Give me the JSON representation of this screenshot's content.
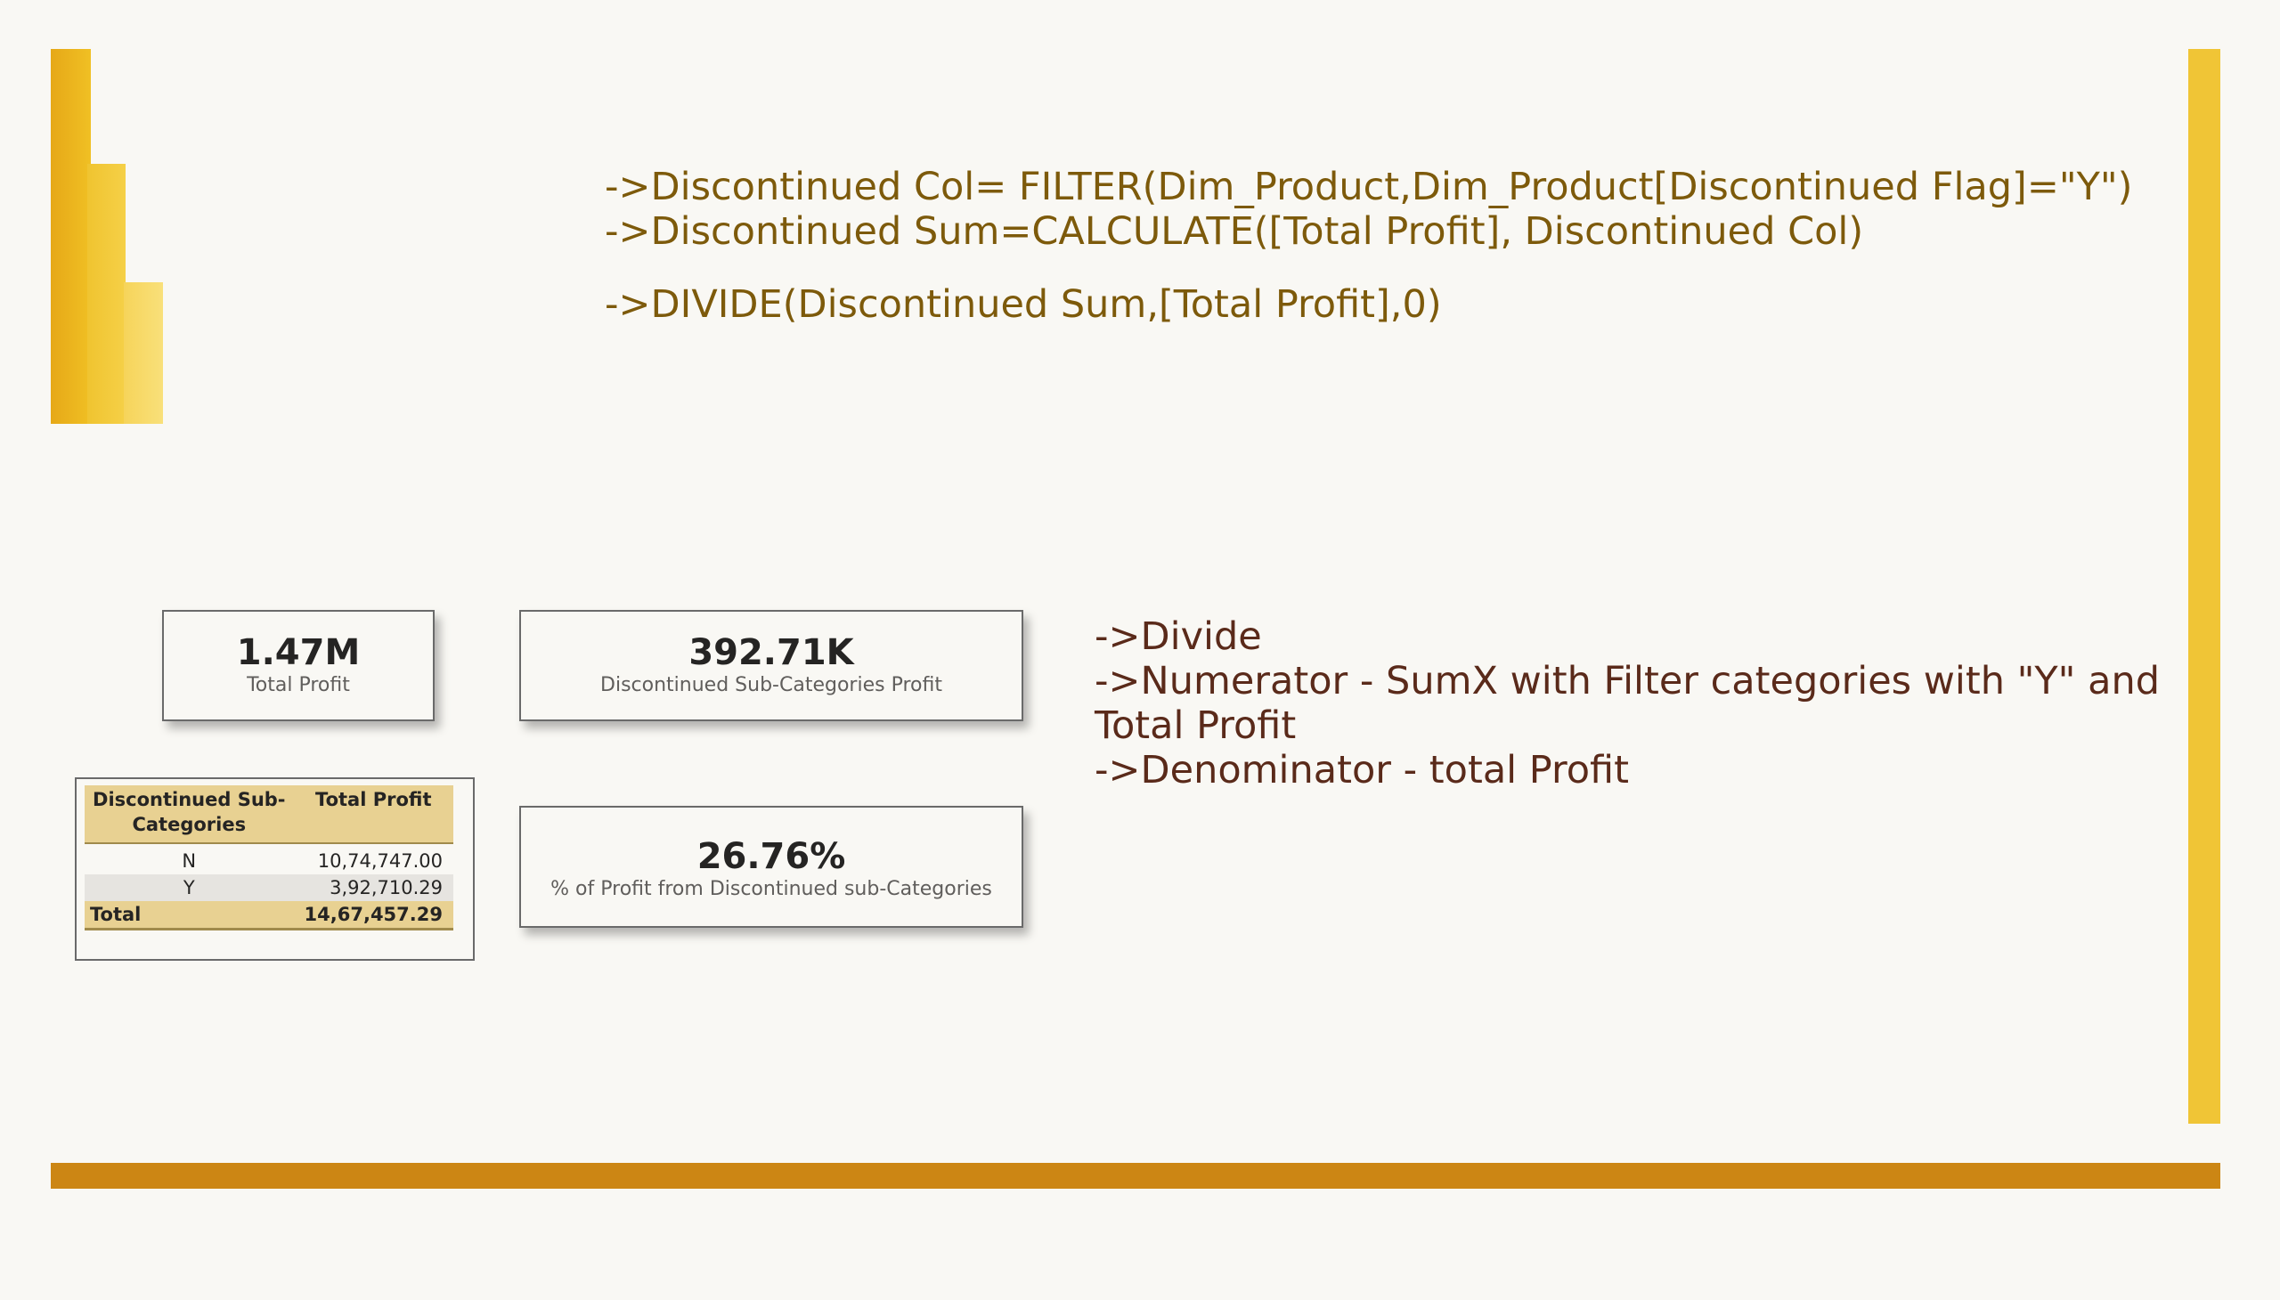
{
  "formulas": {
    "line1": "->Discontinued Col= FILTER(Dim_Product,Dim_Product[Discontinued Flag]=\"Y\")",
    "line2": "->Discontinued Sum=CALCULATE([Total Profit], Discontinued Col)",
    "line3": "->DIVIDE(Discontinued Sum,[Total Profit],0)"
  },
  "explanation": {
    "line1": "->Divide",
    "line2": "->Numerator - SumX with Filter categories with \"Y\" and Total Profit",
    "line3": "->Denominator - total Profit"
  },
  "cards": {
    "total_profit": {
      "value": "1.47M",
      "label": "Total Profit"
    },
    "discontinued_profit": {
      "value": "392.71K",
      "label": "Discontinued Sub-Categories Profit"
    },
    "pct_profit": {
      "value": "26.76%",
      "label": "% of Profit from Discontinued sub-Categories"
    }
  },
  "table": {
    "headers": {
      "category": "Discontinued Sub-Categories",
      "profit": "Total Profit"
    },
    "rows": [
      {
        "category": "N",
        "profit": "10,74,747.00"
      },
      {
        "category": "Y",
        "profit": "3,92,710.29"
      }
    ],
    "total": {
      "label": "Total",
      "profit": "14,67,457.29"
    }
  },
  "colors": {
    "logo_dark": "#e6a817",
    "logo_mid": "#f0c430",
    "logo_light": "#f6d45a",
    "right_accent": "#f0c536",
    "bottom_bar": "#cc8614",
    "formula_text": "#7d5a0b",
    "explain_text": "#5a2a1a",
    "table_header": "#e8d192"
  }
}
